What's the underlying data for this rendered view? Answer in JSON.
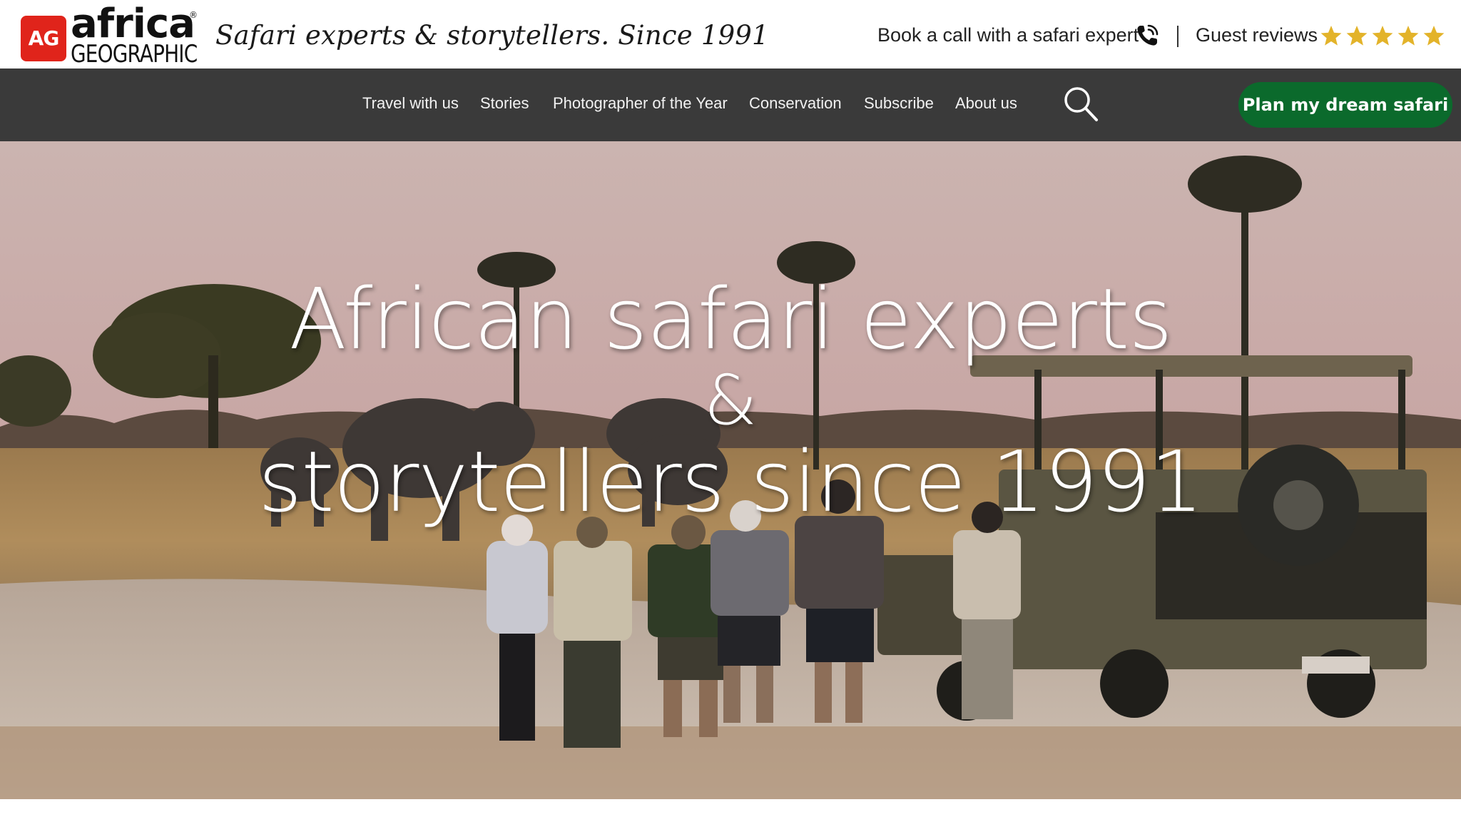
{
  "header": {
    "logo": {
      "badge": "AG",
      "word": "africa",
      "sub": "GEOGRAPHIC",
      "registered": "®"
    },
    "tagline": "Safari experts & storytellers. Since 1991",
    "book_call": "Book a call with a safari expert",
    "guest_reviews": "Guest reviews",
    "rating_stars": 5
  },
  "nav": {
    "items": [
      {
        "label": "Travel with us"
      },
      {
        "label": "Stories"
      },
      {
        "label": "Photographer of the Year"
      },
      {
        "label": "Conservation"
      },
      {
        "label": "Subscribe"
      },
      {
        "label": "About us"
      }
    ],
    "cta": "Plan my dream safari"
  },
  "hero": {
    "line1": "African safari experts",
    "line2": "&",
    "line3": "storytellers since 1991"
  },
  "colors": {
    "brand_red": "#e0241b",
    "nav_bg": "#3a3a3a",
    "cta_green": "#0b6a2c",
    "star_gold": "#e3b32a"
  },
  "icons": {
    "phone": "phone-icon",
    "search": "search-icon",
    "star": "star-icon"
  }
}
